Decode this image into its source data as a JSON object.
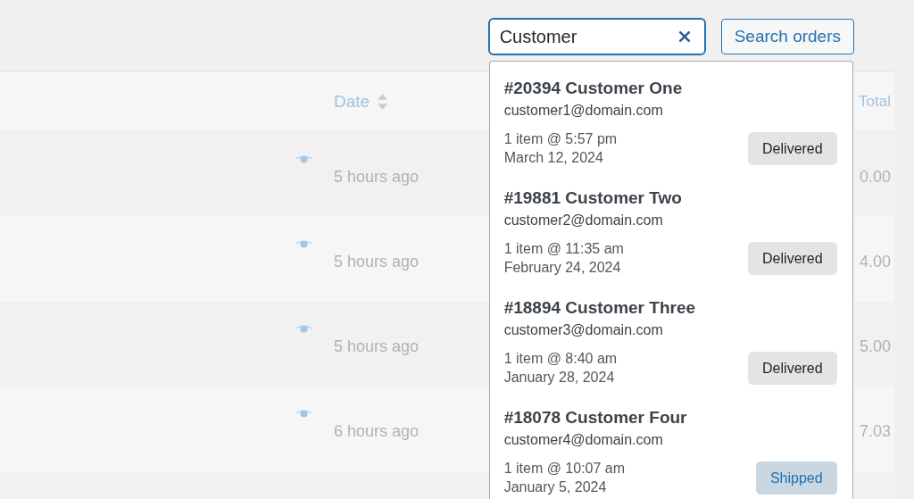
{
  "search": {
    "value": "Customer",
    "button": "Search orders"
  },
  "orders_table": {
    "date_header": "Date",
    "total_header": "Total",
    "rows": [
      {
        "date": "5 hours ago",
        "total": "0.00"
      },
      {
        "date": "5 hours ago",
        "total": "4.00"
      },
      {
        "date": "5 hours ago",
        "total": "5.00"
      },
      {
        "date": "6 hours ago",
        "total": "7.03"
      }
    ]
  },
  "search_results": [
    {
      "title": "#20394 Customer One",
      "email": "customer1@domain.com",
      "items": "1 item @ 5:57 pm",
      "date": "March 12, 2024",
      "status": "Delivered",
      "kind": "delivered"
    },
    {
      "title": "#19881 Customer Two",
      "email": "customer2@domain.com",
      "items": "1 item @ 11:35 am",
      "date": "February 24, 2024",
      "status": "Delivered",
      "kind": "delivered"
    },
    {
      "title": "#18894 Customer Three",
      "email": "customer3@domain.com",
      "items": "1 item @ 8:40 am",
      "date": "January 28, 2024",
      "status": "Delivered",
      "kind": "delivered"
    },
    {
      "title": "#18078 Customer Four",
      "email": "customer4@domain.com",
      "items": "1 item @ 10:07 am",
      "date": "January 5, 2024",
      "status": "Shipped",
      "kind": "shipped"
    }
  ]
}
